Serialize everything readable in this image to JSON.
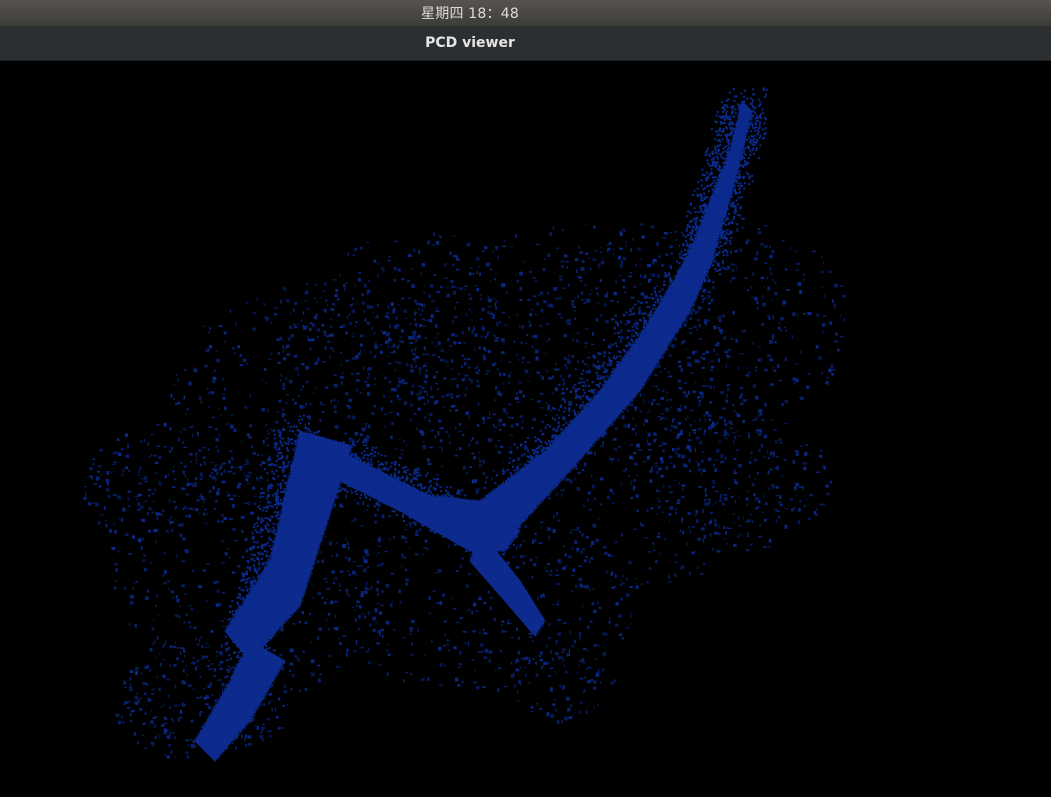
{
  "system_bar": {
    "clock": "星期四 18：48"
  },
  "window": {
    "title": "PCD viewer"
  },
  "viewer": {
    "background_color": "#000000",
    "point_color": "#0a2a8c",
    "content_icon": "point-cloud"
  }
}
